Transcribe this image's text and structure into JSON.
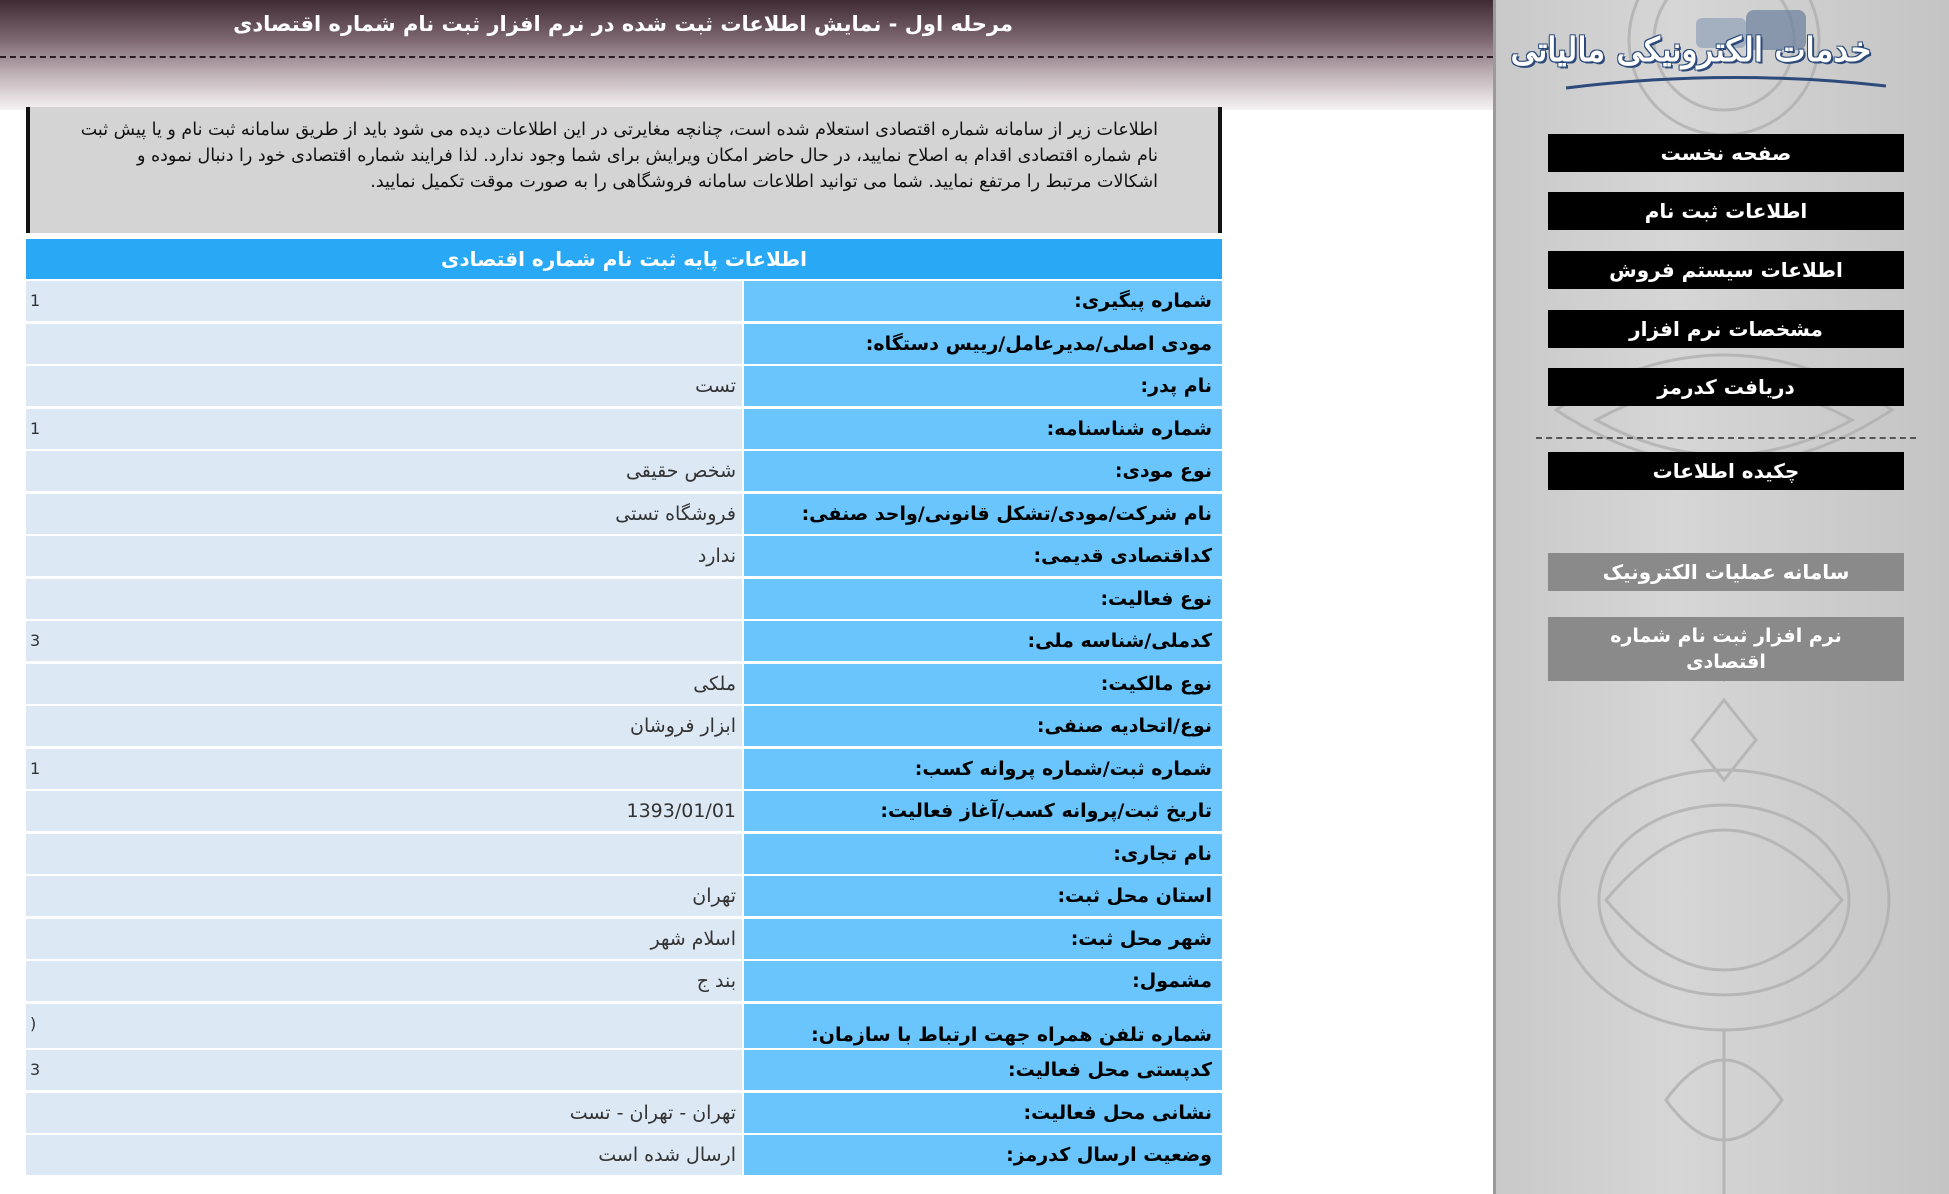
{
  "header": {
    "title": "مرحله اول - نمایش اطلاعات ثبت شده در نرم افزار ثبت نام شماره اقتصادی"
  },
  "sidebar": {
    "logo_text": "خدمات الکترونیکی مالیاتی",
    "nav_items": [
      {
        "label": "صفحه نخست"
      },
      {
        "label": "اطلاعات ثبت نام"
      },
      {
        "label": "اطلاعات سیستم فروش"
      },
      {
        "label": "مشخصات نرم افزار"
      },
      {
        "label": "دریافت کدرمز"
      },
      {
        "label": "چکیده اطلاعات"
      }
    ],
    "links": [
      {
        "label": "سامانه عملیات الکترونیک"
      },
      {
        "label": "نرم افزار ثبت نام شماره اقتصادی"
      }
    ]
  },
  "notice": {
    "text": "اطلاعات زیر از سامانه شماره اقتصادی استعلام شده است، چنانچه مغایرتی در این اطلاعات دیده می شود باید از طریق سامانه ثبت نام و یا پیش ثبت نام شماره اقتصادی اقدام به اصلاح نمایید، در حال حاضر امکان ویرایش برای شما وجود ندارد. لذا فرایند شماره اقتصادی خود را دنبال نموده و اشکالات مرتبط را مرتفع نمایید. شما می توانید اطلاعات سامانه فروشگاهی را به صورت موقت تکمیل نمایید."
  },
  "table": {
    "title": "اطلاعات پایه ثبت نام شماره اقتصادی",
    "rows": [
      {
        "label": "شماره پیگیری:",
        "value": "",
        "stub": "1"
      },
      {
        "label": "مودی اصلی/مدیرعامل/رییس دستگاه:",
        "value": "",
        "stub": ""
      },
      {
        "label": "نام پدر:",
        "value": "تست",
        "stub": ""
      },
      {
        "label": "شماره شناسنامه:",
        "value": "",
        "stub": "1"
      },
      {
        "label": "نوع مودی:",
        "value": "شخص حقیقی",
        "stub": ""
      },
      {
        "label": "نام شرکت/مودی/تشکل قانونی/واحد صنفی:",
        "value": "فروشگاه تستی",
        "stub": ""
      },
      {
        "label": "کداقتصادی قدیمی:",
        "value": "ندارد",
        "stub": ""
      },
      {
        "label": "نوع فعالیت:",
        "value": "",
        "stub": ""
      },
      {
        "label": "کدملی/شناسه ملی:",
        "value": "",
        "stub": "3"
      },
      {
        "label": "نوع مالکیت:",
        "value": "ملکی",
        "stub": ""
      },
      {
        "label": "نوع/اتحادیه صنفی:",
        "value": "ابزار فروشان",
        "stub": ""
      },
      {
        "label": "شماره ثبت/شماره پروانه کسب:",
        "value": "",
        "stub": "1"
      },
      {
        "label": "تاریخ ثبت/پروانه کسب/آغاز فعالیت:",
        "value": "1393/01/01",
        "stub": ""
      },
      {
        "label": "نام تجاری:",
        "value": "",
        "stub": ""
      },
      {
        "label": "استان محل ثبت:",
        "value": "تهران",
        "stub": ""
      },
      {
        "label": "شهر محل ثبت:",
        "value": "اسلام شهر",
        "stub": ""
      },
      {
        "label": "مشمول:",
        "value": "بند ج",
        "stub": ""
      },
      {
        "label": "شماره تلفن همراه جهت ارتباط با سازمان:",
        "value": "",
        "stub": "(",
        "tall": true
      },
      {
        "label": "کدپستی محل فعالیت:",
        "value": "",
        "stub": "3"
      },
      {
        "label": "نشانی محل فعالیت:",
        "value": "تهران - تهران - تست",
        "stub": ""
      },
      {
        "label": "وضعیت ارسال کدرمز:",
        "value": "ارسال شده است",
        "stub": ""
      }
    ]
  },
  "colors": {
    "header_dark": "#3f2a33",
    "table_header": "#29a8f5",
    "label_cell": "#69c5fb",
    "value_cell": "#dce8f4",
    "nav_button": "#000000",
    "link_button": "#8a8a8a"
  }
}
